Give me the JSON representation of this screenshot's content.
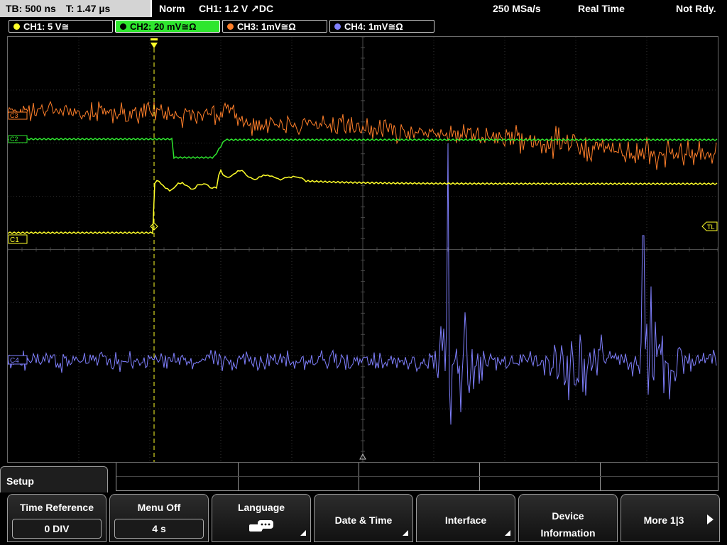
{
  "status": {
    "timebase": "TB: 500 ns",
    "trigger_time": "T: 1.47 µs",
    "mode": "Norm",
    "trigger_source": "CH1: 1.2 V ↗DC",
    "sample_rate": "250 MSa/s",
    "acq_mode": "Real Time",
    "ready_state": "Not Rdy."
  },
  "channels": [
    {
      "label": "CH1: 5 V≅",
      "color": "#ffff2a"
    },
    {
      "label": "CH2: 20 mV≅Ω",
      "color": "#2ee62e"
    },
    {
      "label": "CH3: 1mV≅Ω",
      "color": "#ff7f2a"
    },
    {
      "label": "CH4: 1mV≅Ω",
      "color": "#8080ff"
    }
  ],
  "markers": {
    "ch1": "C1",
    "ch2": "C2",
    "ch3": "C3",
    "ch4": "C4",
    "trigger_level": "TL"
  },
  "menu": {
    "title": "Setup",
    "time_reference_label": "Time Reference",
    "time_reference_value": "0 DIV",
    "menu_off_label": "Menu Off",
    "menu_off_value": "4 s",
    "language_label": "Language",
    "date_time_label": "Date & Time",
    "interface_label": "Interface",
    "device_information_line1": "Device",
    "device_information_line2": "Information",
    "more_label": "More 1|3"
  },
  "colors": {
    "ch1": "#ffff2a",
    "ch2": "#2ee62e",
    "ch3": "#ff7f2a",
    "ch4": "#8080ff",
    "grid": "#555555"
  },
  "icons": {
    "language": "keyboard-speech-icon",
    "trigger": "trigger-marker-icon",
    "more": "arrow-right-icon"
  }
}
